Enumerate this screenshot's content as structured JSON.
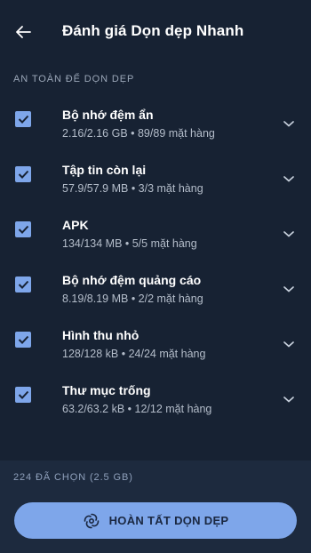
{
  "header": {
    "title": "Đánh giá Dọn dẹp Nhanh",
    "back_icon": "arrow-left-icon"
  },
  "section": {
    "label": "AN TOÀN ĐỂ DỌN DẸP"
  },
  "items": [
    {
      "title": "Bộ nhớ đệm ẩn",
      "subtitle": "2.16/2.16 GB • 89/89 mặt hàng",
      "checked": true
    },
    {
      "title": "Tập tin còn lại",
      "subtitle": "57.9/57.9 MB • 3/3 mặt hàng",
      "checked": true
    },
    {
      "title": "APK",
      "subtitle": "134/134 MB • 5/5 mặt hàng",
      "checked": true
    },
    {
      "title": "Bộ nhớ đệm quảng cáo",
      "subtitle": "8.19/8.19 MB • 2/2 mặt hàng",
      "checked": true
    },
    {
      "title": "Hình thu nhỏ",
      "subtitle": "128/128 kB • 24/24 mặt hàng",
      "checked": true
    },
    {
      "title": "Thư mục trống",
      "subtitle": "63.2/63.2 kB • 12/12 mặt hàng",
      "checked": true
    }
  ],
  "footer": {
    "selected_count": "224 ĐÃ CHỌN (2.5 GB)",
    "button_label": "HOÀN TẤT DỌN DẸP",
    "button_icon": "cleaning-swirl-icon"
  },
  "colors": {
    "background": "#172233",
    "footer_background": "#1d2a3e",
    "accent": "#7ea6ea",
    "subtitle": "#b4bdca",
    "section_label": "#9aa6b7"
  }
}
